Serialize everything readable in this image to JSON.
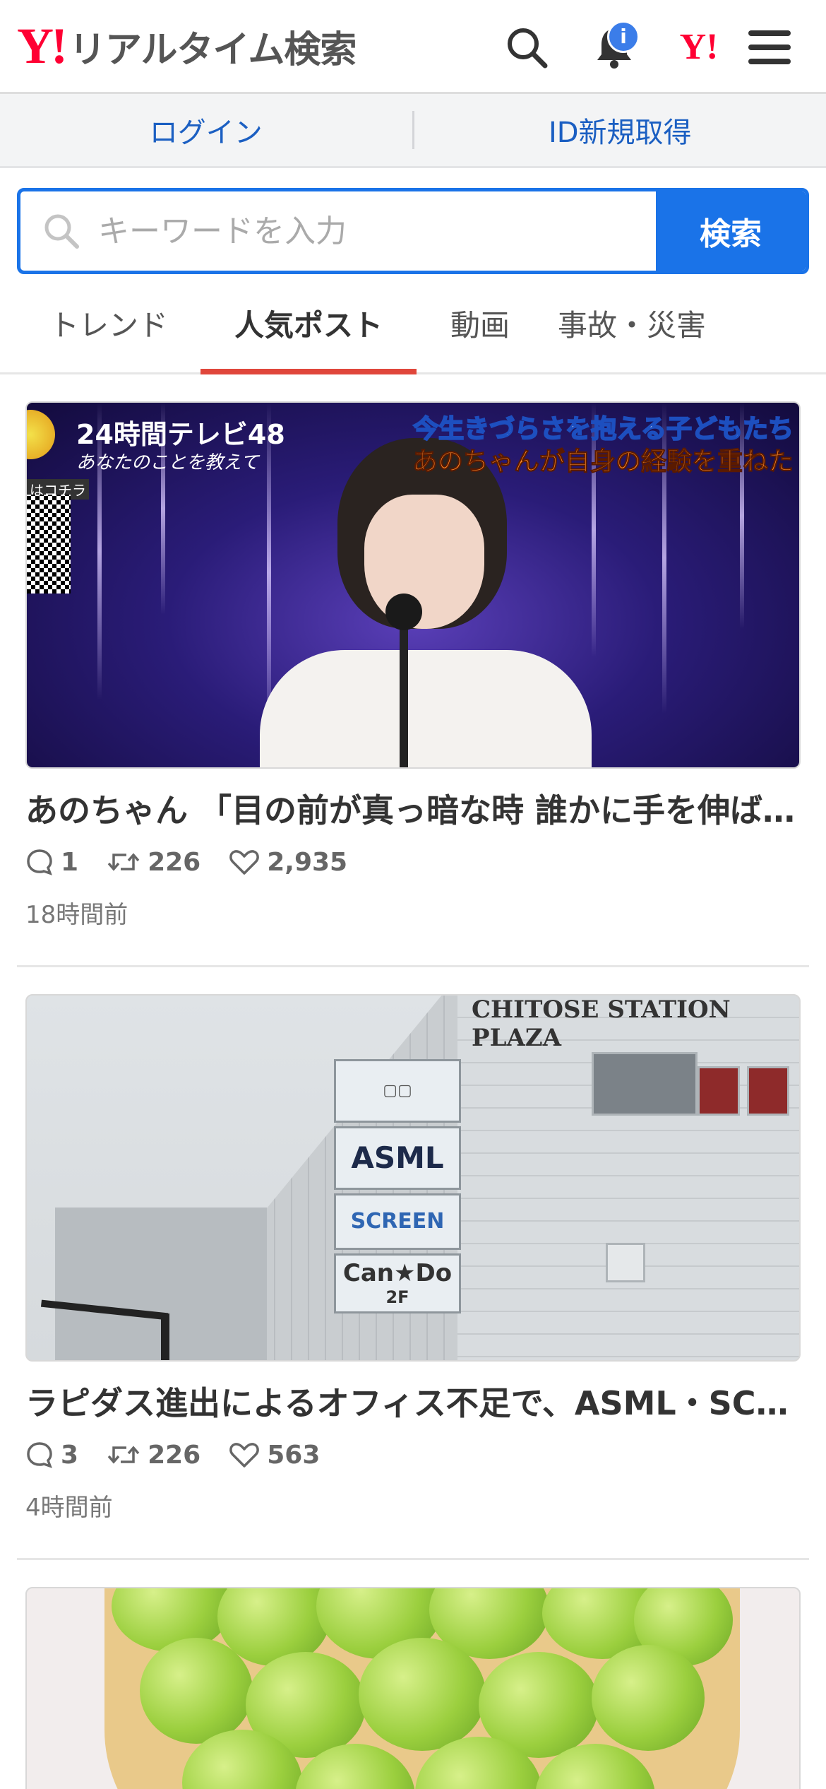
{
  "header": {
    "logo_mark": "Y!",
    "title": "リアルタイム検索",
    "notification_badge": "i",
    "yj_mark": "Y!"
  },
  "auth": {
    "login_label": "ログイン",
    "signup_label": "ID新規取得"
  },
  "search": {
    "placeholder": "キーワードを入力",
    "button_label": "検索"
  },
  "tabs": [
    {
      "label": "トレンド",
      "active": false
    },
    {
      "label": "人気ポスト",
      "active": true
    },
    {
      "label": "動画",
      "active": false
    },
    {
      "label": "事故・災害",
      "active": false
    }
  ],
  "posts": [
    {
      "title": "あのちゃん 「目の前が真っ暗な時 誰かに手を伸ばして…",
      "replies": "1",
      "reposts": "226",
      "likes": "2,935",
      "time": "18時間前",
      "image": {
        "logo": "24時間テレビ48",
        "logo_sub": "あなたのことを教えて",
        "caption_1": "今生きづらさを抱える子どもたち",
        "caption_2": "あのちゃんが自身の経験を重ねた",
        "qr_label": "はコチラ"
      }
    },
    {
      "title": "ラピダス進出によるオフィス不足で、ASML・SCREEN…",
      "replies": "3",
      "reposts": "226",
      "likes": "563",
      "time": "4時間前",
      "image": {
        "plaza_sign": "CHITOSE STATION PLAZA",
        "panel_1": "ASML",
        "panel_2": "SCREEN",
        "panel_3": "Can★Do",
        "panel_3_floor": "2F"
      }
    },
    {
      "title": "",
      "image": {}
    }
  ],
  "colors": {
    "brand_red": "#ff0033",
    "accent_blue": "#1a73e8",
    "tab_indicator": "#e0463b",
    "link_blue": "#1b5fc2"
  }
}
